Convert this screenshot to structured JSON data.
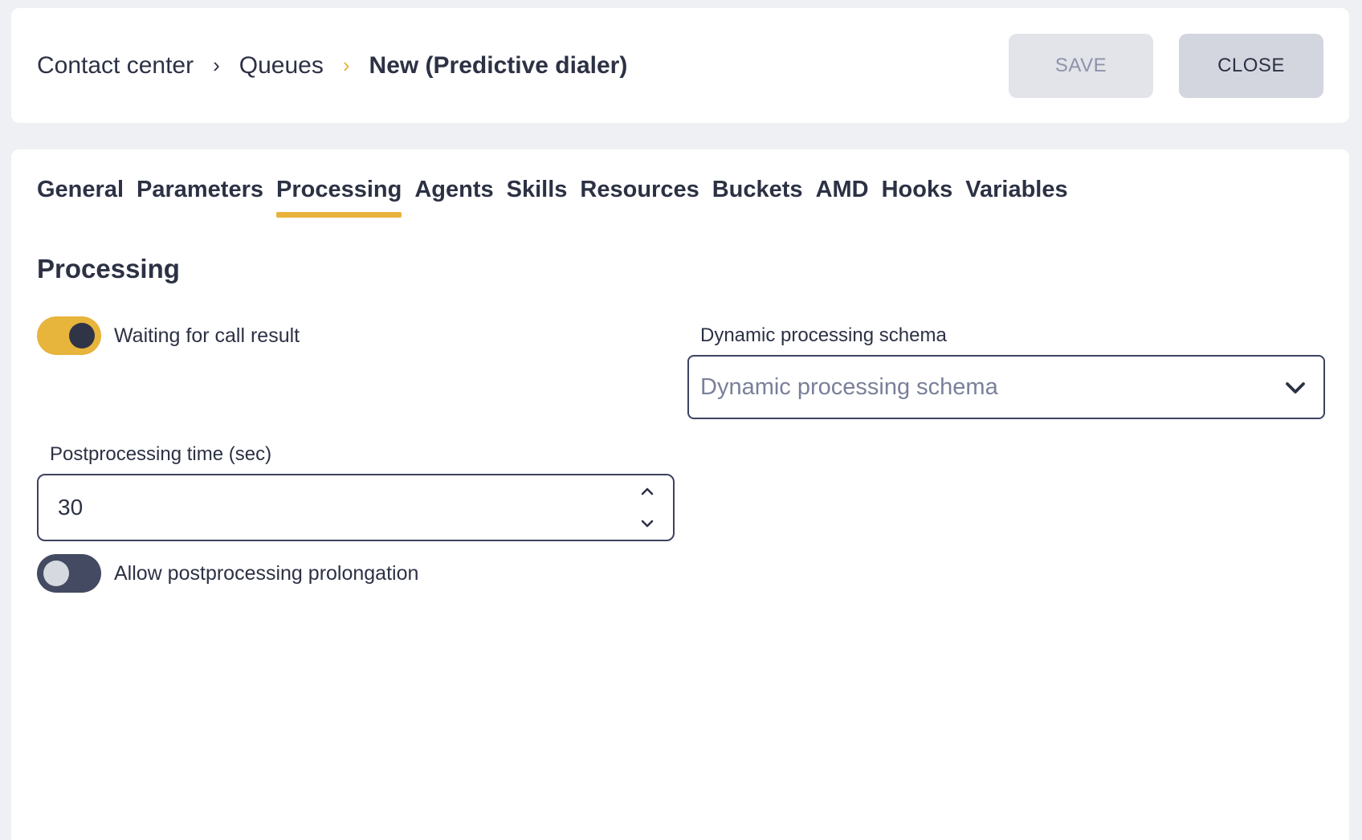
{
  "breadcrumb": {
    "items": [
      "Contact center",
      "Queues",
      "New (Predictive dialer)"
    ]
  },
  "header": {
    "save_label": "SAVE",
    "close_label": "CLOSE"
  },
  "tabs": [
    {
      "label": "General"
    },
    {
      "label": "Parameters"
    },
    {
      "label": "Processing",
      "active": true
    },
    {
      "label": "Agents"
    },
    {
      "label": "Skills"
    },
    {
      "label": "Resources"
    },
    {
      "label": "Buckets"
    },
    {
      "label": "AMD"
    },
    {
      "label": "Hooks"
    },
    {
      "label": "Variables"
    }
  ],
  "section": {
    "title": "Processing"
  },
  "form": {
    "waiting_for_call_result": {
      "label": "Waiting for call result",
      "on": true
    },
    "dynamic_schema": {
      "label": "Dynamic processing schema",
      "placeholder": "Dynamic processing schema"
    },
    "postprocessing_time": {
      "label": "Postprocessing time (sec)",
      "value": "30"
    },
    "allow_prolongation": {
      "label": "Allow postprocessing prolongation",
      "on": false
    }
  },
  "colors": {
    "accent": "#e8b23c",
    "toggle_off": "#434a62",
    "text": "#2c3144"
  },
  "icons": {
    "breadcrumb_separator": "chevron-right-icon",
    "select_arrow": "chevron-down-icon",
    "stepper_up": "chevron-up-icon",
    "stepper_down": "chevron-down-icon"
  }
}
